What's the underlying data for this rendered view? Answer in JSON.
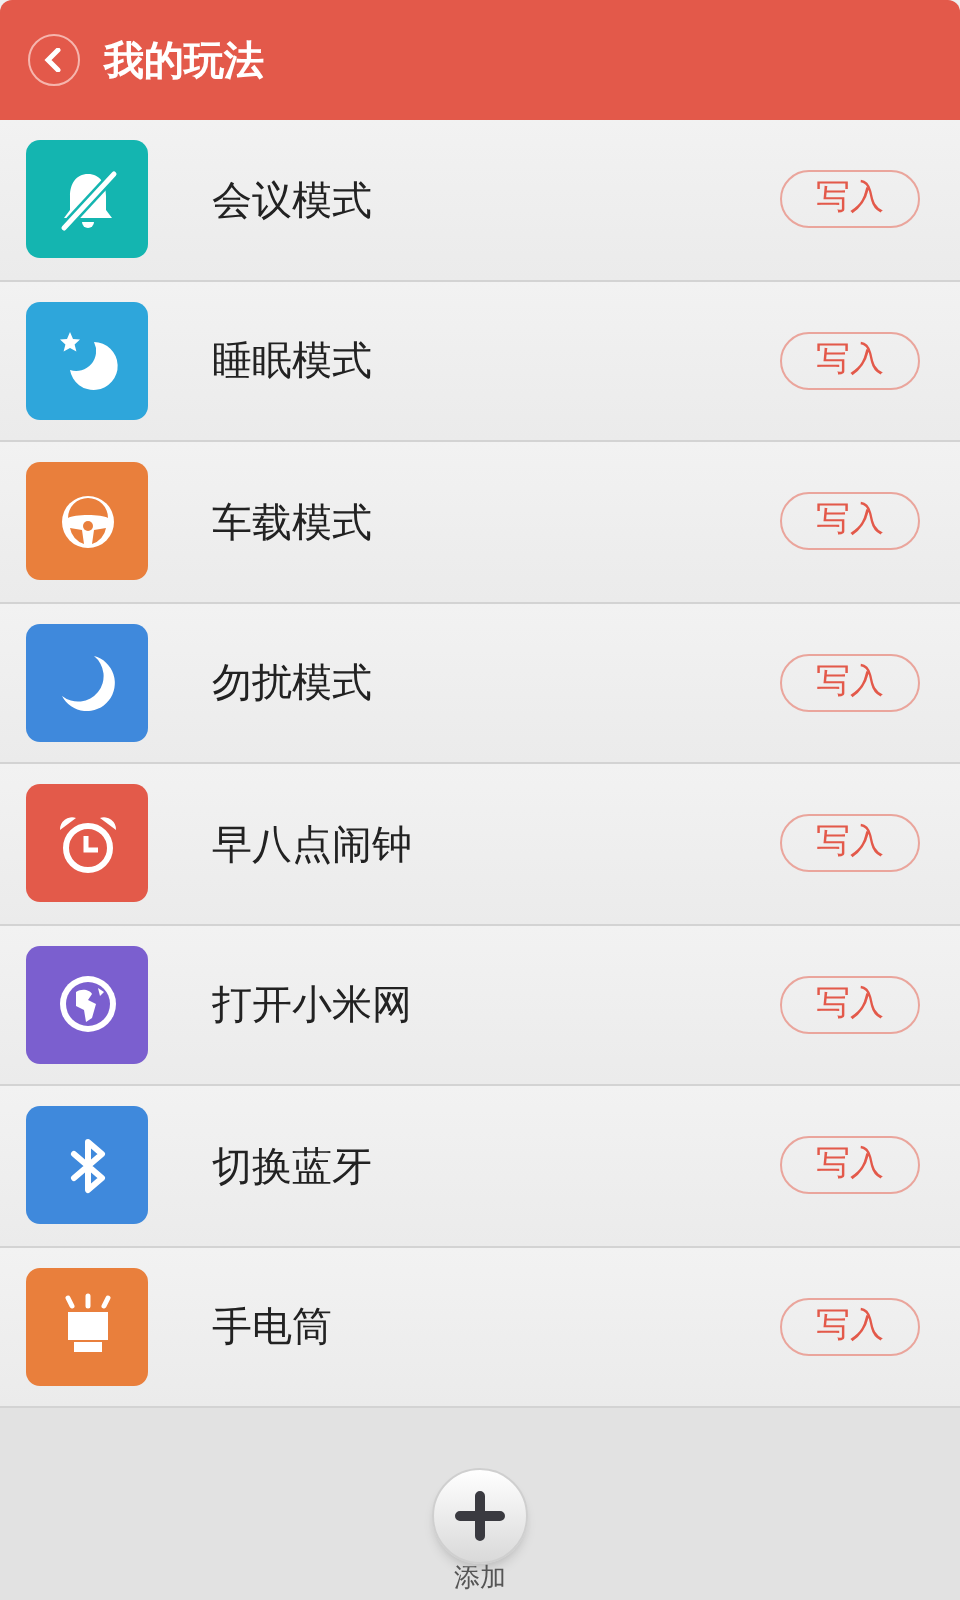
{
  "header": {
    "title": "我的玩法"
  },
  "items": [
    {
      "kind": "mute",
      "color": "#14b5b0",
      "name": "会议模式",
      "action": "写入"
    },
    {
      "kind": "sleep",
      "color": "#2ea6db",
      "name": "睡眠模式",
      "action": "写入"
    },
    {
      "kind": "car",
      "color": "#e97f3c",
      "name": "车载模式",
      "action": "写入"
    },
    {
      "kind": "moon",
      "color": "#3f89dc",
      "name": "勿扰模式",
      "action": "写入"
    },
    {
      "kind": "alarm",
      "color": "#e35a4a",
      "name": "早八点闹钟",
      "action": "写入"
    },
    {
      "kind": "globe",
      "color": "#7b5fcf",
      "name": "打开小米网",
      "action": "写入"
    },
    {
      "kind": "bluetooth",
      "color": "#3f89dc",
      "name": "切换蓝牙",
      "action": "写入"
    },
    {
      "kind": "flashlight",
      "color": "#e97f3c",
      "name": "手电筒",
      "action": "写入"
    }
  ],
  "add": {
    "label": "添加"
  }
}
